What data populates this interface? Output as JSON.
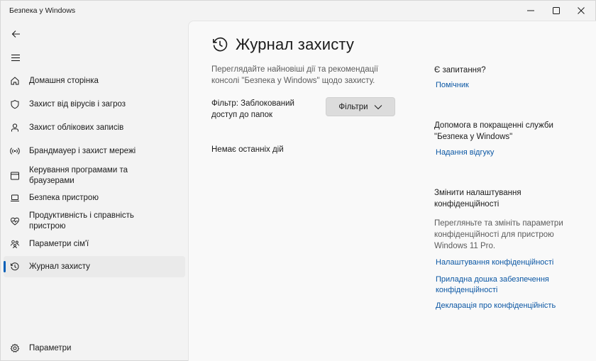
{
  "window": {
    "title": "Безпека у Windows",
    "controls": [
      "minimize-icon",
      "maximize-icon",
      "close-icon"
    ]
  },
  "sidebar": {
    "back_icon": "back-arrow-icon",
    "menu_icon": "hamburger-icon",
    "items": [
      {
        "label": "Домашня сторінка",
        "icon": "home-icon"
      },
      {
        "label": "Захист від вірусів і загроз",
        "icon": "shield-icon"
      },
      {
        "label": "Захист облікових записів",
        "icon": "person-icon"
      },
      {
        "label": "Брандмауер і захист мережі",
        "icon": "wireless-icon"
      },
      {
        "label": "Керування програмами та браузерами",
        "icon": "app-window-icon"
      },
      {
        "label": "Безпека пристрою",
        "icon": "laptop-icon"
      },
      {
        "label": "Продуктивність і справність пристрою",
        "icon": "heart-pulse-icon"
      },
      {
        "label": "Параметри сім'ї",
        "icon": "family-icon"
      },
      {
        "label": "Журнал захисту",
        "icon": "history-icon",
        "active": true
      }
    ],
    "settings": {
      "label": "Параметри",
      "icon": "gear-icon"
    }
  },
  "main": {
    "title": "Журнал захисту",
    "description": "Переглядайте найновіші дії та рекомендації консолі \"Безпека у Windows\" щодо захисту.",
    "filter_label": "Фільтр: Заблокований доступ до папок",
    "filter_button": "Фільтри",
    "empty_text": "Немає останніх дій"
  },
  "right_panel": {
    "questions_heading": "Є запитання?",
    "help_link": "Помічник",
    "improve_heading": "Допомога в покращенні служби \"Безпека у Windows\"",
    "feedback_link": "Надання відгуку",
    "privacy_heading": "Змінити налаштування конфіденційності",
    "privacy_text": "Перегляньте та змініть параметри конфіденційності для пристрою Windows 11 Pro.",
    "privacy_settings_link": "Налаштування конфіденційності",
    "dashboard_link": "Приладна дошка забезпечення конфіденційності",
    "statement_link": "Декларація про конфіденційність"
  },
  "colors": {
    "accent": "#005fb8",
    "link": "#0b57a4",
    "background": "#f3f3f3",
    "content_background": "#f9f9f9"
  }
}
